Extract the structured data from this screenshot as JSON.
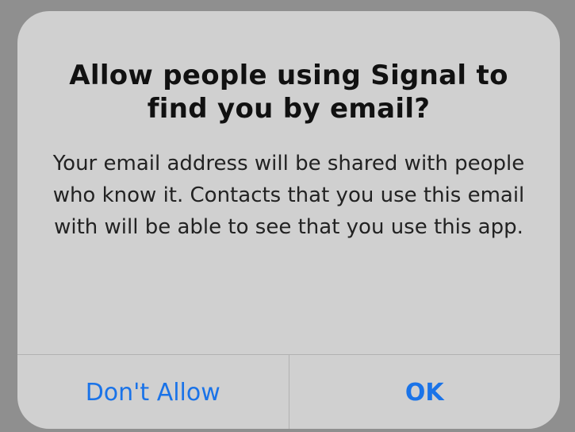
{
  "alert": {
    "title": "Allow people using Signal to find you by email?",
    "message": "Your email address will be shared with people who know it. Contacts that you use this email with will be able to see that you use this app.",
    "buttons": {
      "deny_label": "Don't Allow",
      "allow_label": "OK"
    }
  },
  "colors": {
    "backdrop": "#8f8f8f",
    "sheet": "#d0d0d0",
    "button_text": "#1a73e8"
  }
}
